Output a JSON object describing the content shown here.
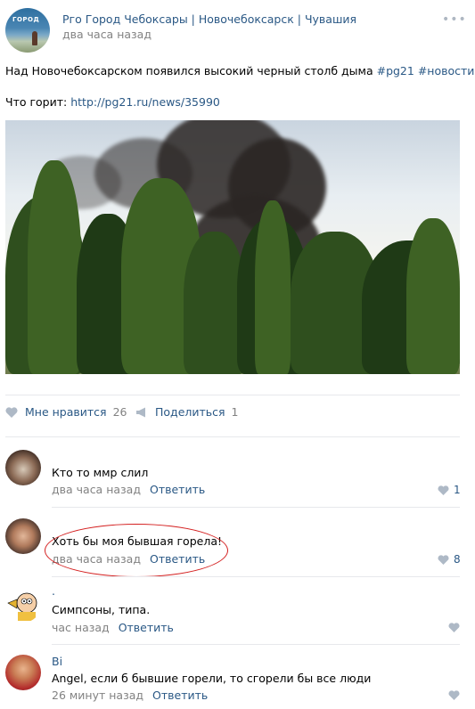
{
  "post": {
    "group_name": "Рго Город Чебоксары | Новочебоксарск | Чувашия",
    "time": "два часа назад",
    "text_main": "Над Новочебоксарском появился высокий черный столб дыма",
    "hashtags": "#pg21 #новости",
    "link_label": "Что горит:",
    "link_url": "http://pg21.ru/news/35990",
    "avatar_logo": "ГОРОД",
    "likes_label": "Мне нравится",
    "likes_count": "26",
    "share_label": "Поделиться",
    "share_count": "1"
  },
  "comments": [
    {
      "author": "",
      "text": "Кто то ммр слил",
      "time": "два часа назад",
      "reply": "Ответить",
      "likes": "1"
    },
    {
      "author": "",
      "text": "Хоть бы моя бывшая горела!",
      "time": "два часа назад",
      "reply": "Ответить",
      "likes": "8"
    },
    {
      "author": ".",
      "text": "Симпсоны, типа.",
      "time": "час назад",
      "reply": "Ответить",
      "likes": ""
    },
    {
      "author": "Ві",
      "text": "Angel, если б бывшие горели, то сгорели бы все люди",
      "time": "26 минут назад",
      "reply": "Ответить",
      "likes": ""
    }
  ],
  "colors": {
    "link": "#2a5885",
    "muted": "#828282",
    "like_icon": "#aeb9c6",
    "annotation": "#d42020"
  }
}
